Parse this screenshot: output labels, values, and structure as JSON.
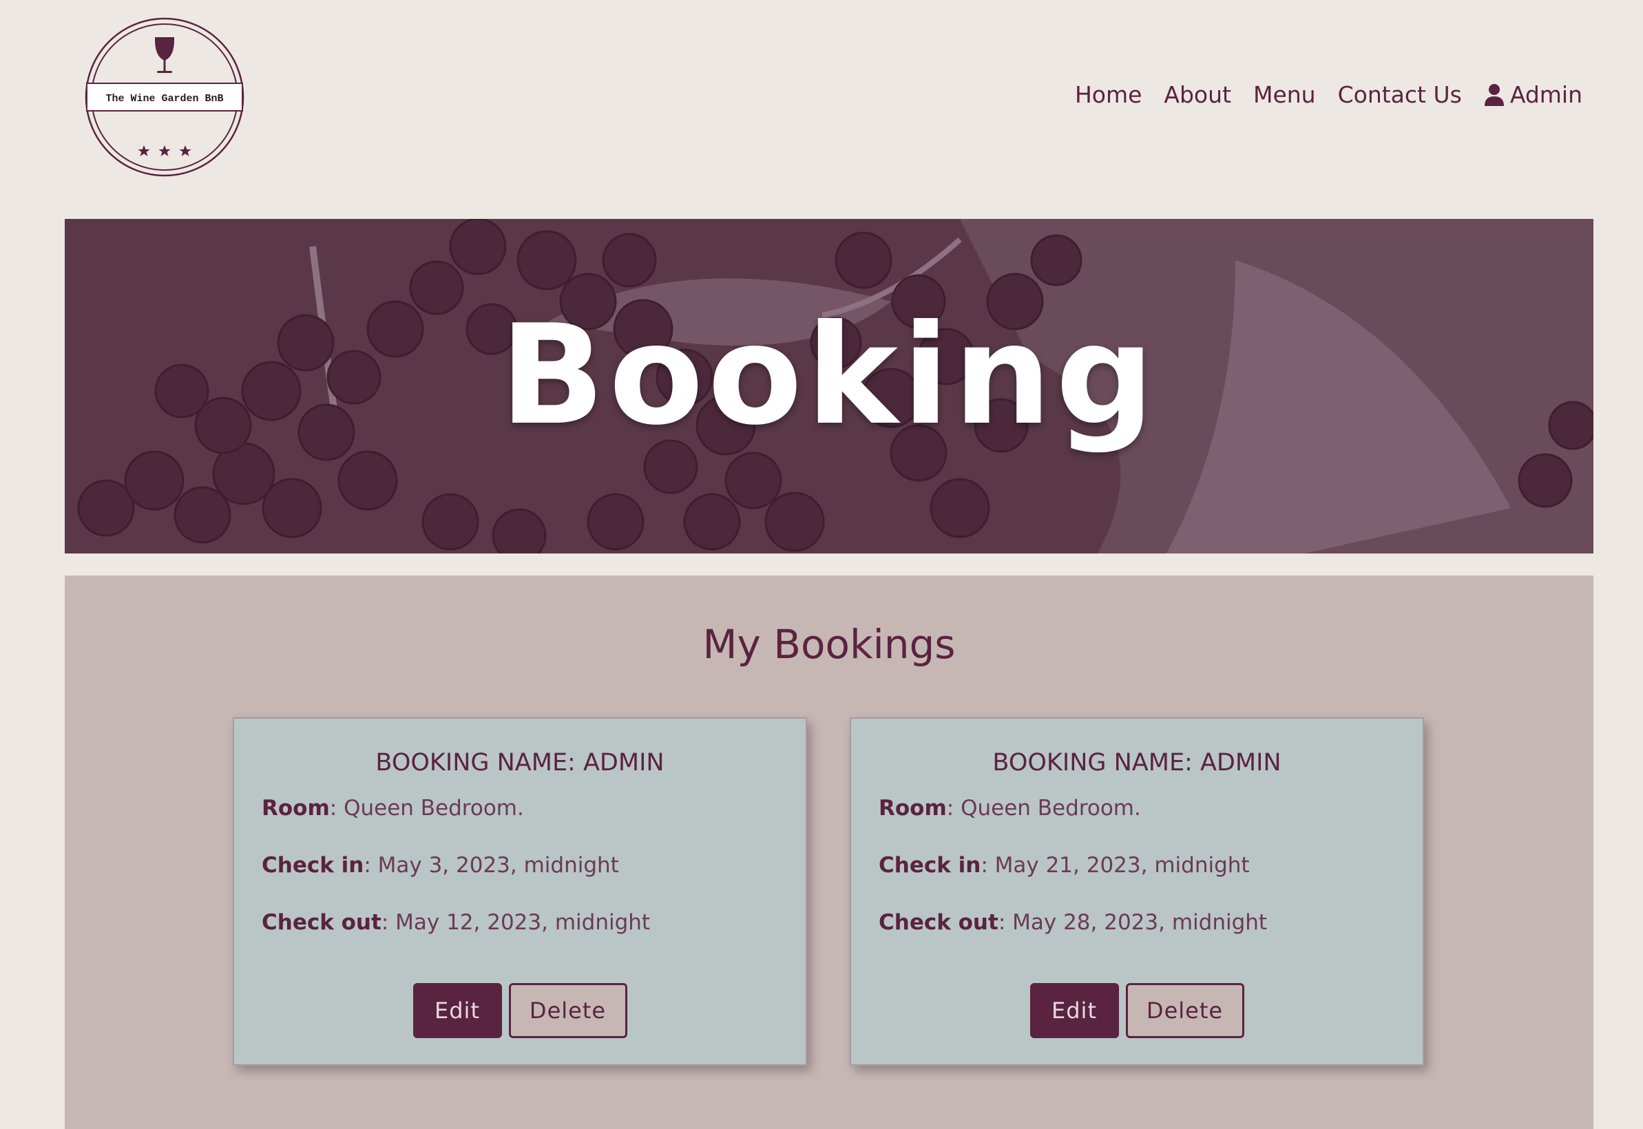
{
  "logo": {
    "text": "The Wine Garden BnB",
    "icon": "wine-glass-icon"
  },
  "nav": {
    "items": [
      "Home",
      "About",
      "Menu",
      "Contact Us"
    ],
    "admin": {
      "label": "Admin",
      "icon": "user-icon"
    }
  },
  "hero": {
    "title": "Booking"
  },
  "bookings": {
    "title": "My Bookings",
    "cards": [
      {
        "title": "BOOKING NAME: ADMIN",
        "room_label": "Room",
        "room": ": Queen Bedroom.",
        "checkin_label": "Check in",
        "checkin": ": May 3, 2023, midnight",
        "checkout_label": "Check out",
        "checkout": ": May 12, 2023, midnight",
        "edit": "Edit",
        "delete": "Delete"
      },
      {
        "title": "BOOKING NAME: ADMIN",
        "room_label": "Room",
        "room": ": Queen Bedroom.",
        "checkin_label": "Check in",
        "checkin": ": May 21, 2023, midnight",
        "checkout_label": "Check out",
        "checkout": ": May 28, 2023, midnight",
        "edit": "Edit",
        "delete": "Delete"
      }
    ]
  },
  "colors": {
    "brand": "#5a2340",
    "page_bg": "#ede8e3",
    "section_bg": "#c6b7b4",
    "card_bg": "#bac6c6"
  }
}
